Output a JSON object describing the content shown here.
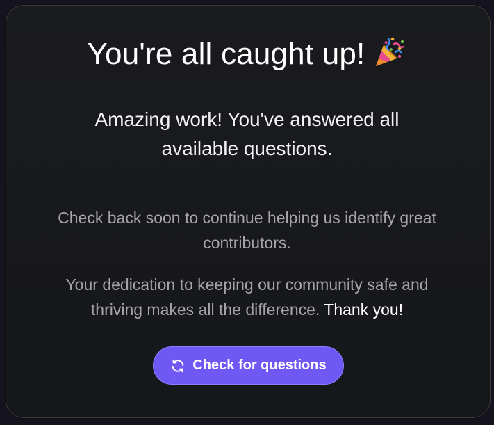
{
  "card": {
    "title": "You're all caught up!",
    "title_icon": "party-popper-icon",
    "subtitle_line1": "Amazing work! You've answered all",
    "subtitle_line2": "available questions.",
    "para1_line1": "Check back soon to continue helping us identify great",
    "para1_line2": "contributors.",
    "para2_line1": "Your dedication to keeping our community safe and",
    "para2_line2": "thriving makes all the difference.",
    "para2_thanks": "Thank you!",
    "button_label": "Check for questions",
    "button_icon": "refresh-icon"
  },
  "colors": {
    "accent": "#7058f5",
    "muted_text": "#a4a4aa",
    "card_bg": "#1a1b1e"
  }
}
